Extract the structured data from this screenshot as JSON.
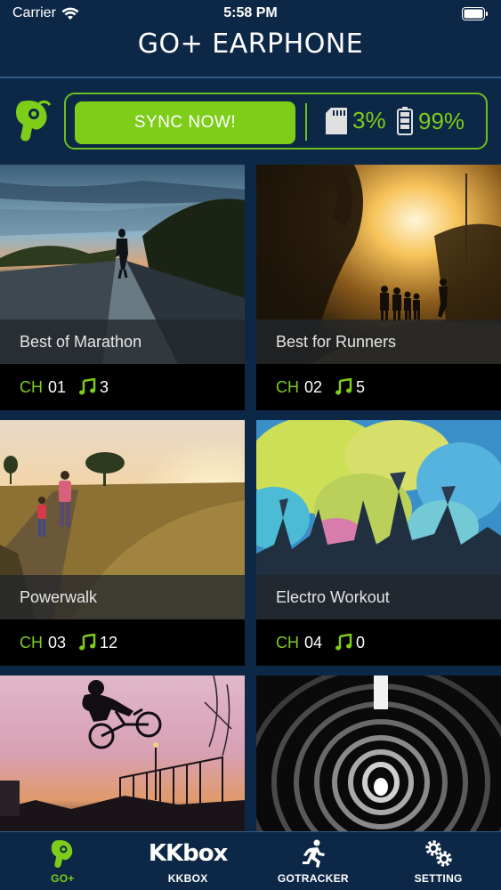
{
  "status": {
    "carrier": "Carrier",
    "time": "5:58 PM"
  },
  "nav": {
    "title": "GO+ EARPHONE"
  },
  "sync": {
    "button_label": "SYNC NOW!",
    "storage": "3%",
    "battery": "99%"
  },
  "cards": [
    {
      "title": "Best of Marathon",
      "ch_label": "CH",
      "ch_num": "01",
      "count": "3"
    },
    {
      "title": "Best for Runners",
      "ch_label": "CH",
      "ch_num": "02",
      "count": "5"
    },
    {
      "title": "Powerwalk",
      "ch_label": "CH",
      "ch_num": "03",
      "count": "12"
    },
    {
      "title": "Electro Workout",
      "ch_label": "CH",
      "ch_num": "04",
      "count": "0"
    }
  ],
  "tabs": [
    {
      "label": "GO+",
      "icon": "earphone-icon"
    },
    {
      "label": "KKBOX",
      "icon": "kkbox-logo",
      "logo_text": "KKbox"
    },
    {
      "label": "GOTRACKER",
      "icon": "runner-icon"
    },
    {
      "label": "SETTING",
      "icon": "gear-icon"
    }
  ],
  "colors": {
    "accent": "#7dcd19",
    "background": "#0d2847"
  }
}
